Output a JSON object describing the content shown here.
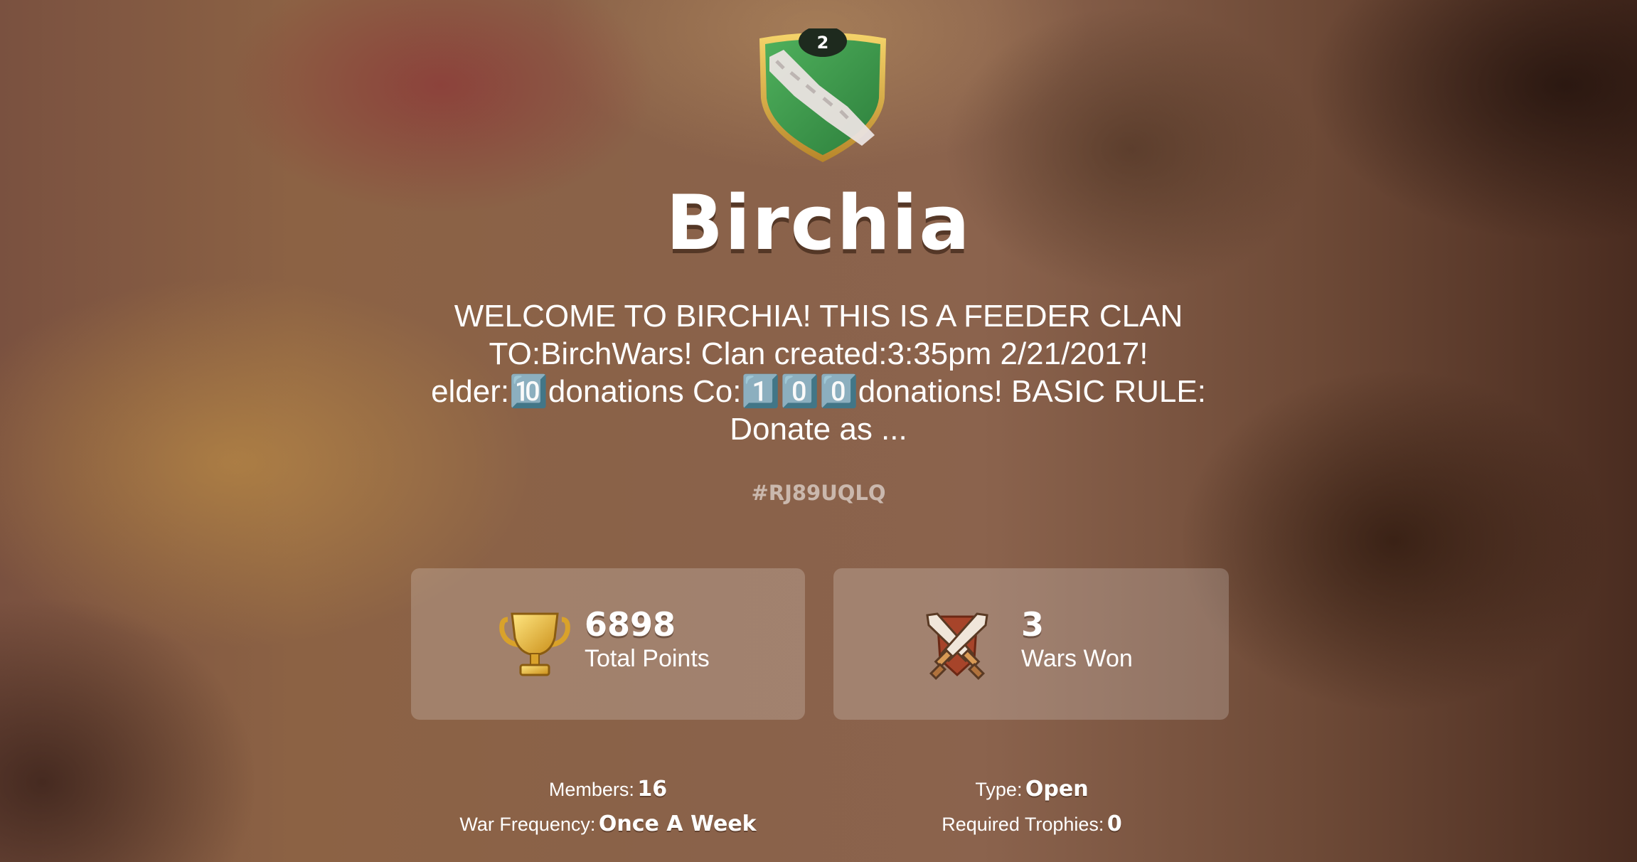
{
  "clan": {
    "level": "2",
    "name": "Birchia",
    "description": "WELCOME TO BIRCHIA! THIS IS A FEEDER CLAN TO:BirchWars! Clan created:3:35pm 2/21/2017! elder:🔟donations Co:1️⃣0️⃣0️⃣donations! BASIC RULE: Donate as ...",
    "tag": "#RJ89UQLQ"
  },
  "stats": {
    "points": {
      "value": "6898",
      "label": "Total Points",
      "icon": "trophy-icon"
    },
    "wars": {
      "value": "3",
      "label": "Wars Won",
      "icon": "crossed-swords-icon"
    }
  },
  "info": {
    "members": {
      "label": "Members:",
      "value": "16"
    },
    "type": {
      "label": "Type:",
      "value": "Open"
    },
    "war_frequency": {
      "label": "War Frequency:",
      "value": "Once A Week"
    },
    "required_trophies": {
      "label": "Required Trophies:",
      "value": "0"
    }
  },
  "colors": {
    "badge_green": "#3d9a4e",
    "badge_gold": "#e8b640",
    "card_bg": "rgba(255,255,255,0.2)"
  }
}
